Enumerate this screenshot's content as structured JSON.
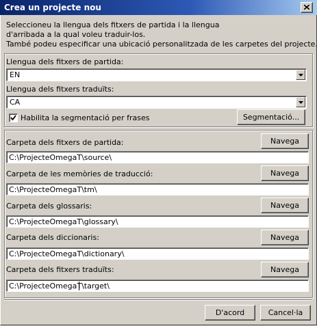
{
  "window": {
    "title": "Crea un projecte nou"
  },
  "intro": [
    "Seleccioneu la llengua dels fitxers de partida i la llengua",
    "d'arribada a la qual voleu traduir-los.",
    "També podeu especificar una ubicació personalitzada de les carpetes del projecte."
  ],
  "source_lang": {
    "label": "Llengua dels fitxers de partida:",
    "value": "EN"
  },
  "target_lang": {
    "label": "Llengua dels fitxers traduïts:",
    "value": "CA"
  },
  "segmentation": {
    "checkbox_label": "Habilita la segmentació per frases",
    "checked": true,
    "button": "Segmentació..."
  },
  "folders": [
    {
      "label": "Carpeta dels fitxers de partida:",
      "button": "Navega",
      "path": "C:\\ProjecteOmegaT\\source\\"
    },
    {
      "label": "Carpeta de les memòries de traducció:",
      "button": "Navega",
      "path": "C:\\ProjecteOmegaT\\tm\\"
    },
    {
      "label": "Carpeta dels glossaris:",
      "button": "Navega",
      "path": "C:\\ProjecteOmegaT\\glossary\\"
    },
    {
      "label": "Carpeta dels diccionaris:",
      "button": "Navega",
      "path": "C:\\ProjecteOmegaT\\dictionary\\"
    },
    {
      "label": "Carpeta dels fitxers traduïts:",
      "button": "Navega",
      "path": "C:\\ProjecteOmegaT\\target\\"
    }
  ],
  "footer": {
    "ok": "D'acord",
    "cancel": "Cancel·la"
  }
}
